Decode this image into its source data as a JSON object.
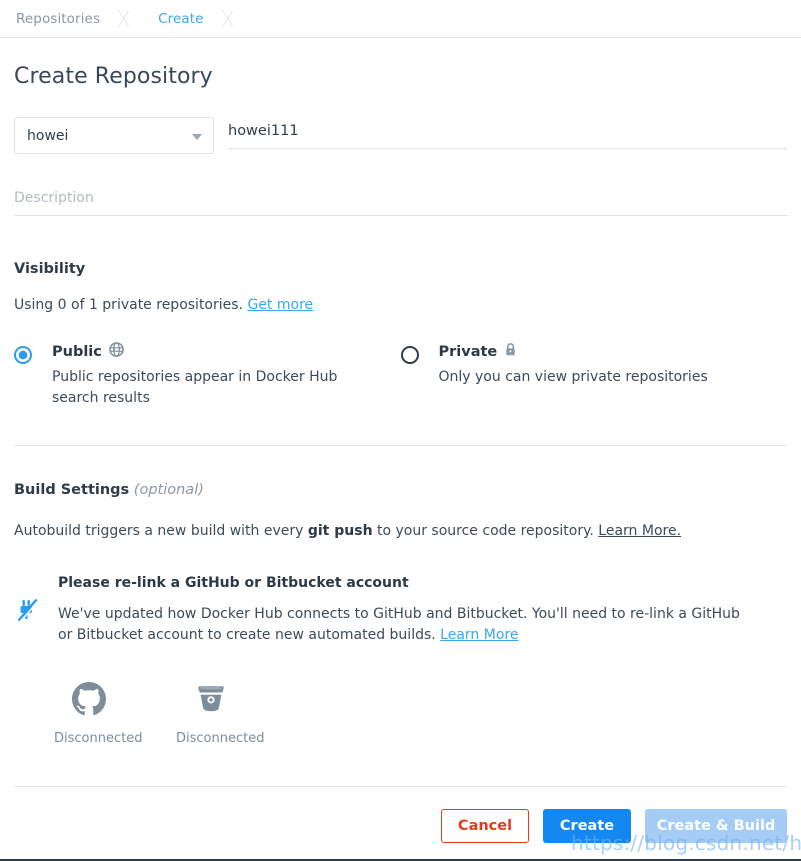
{
  "breadcrumb": {
    "repositories": "Repositories",
    "create": "Create"
  },
  "page_title": "Create Repository",
  "form": {
    "namespace_value": "howei",
    "namespace_caret_icon": "chevron-down-icon",
    "name_value": "howei111",
    "name_placeholder": "",
    "description_value": "",
    "description_placeholder": "Description"
  },
  "visibility": {
    "title": "Visibility",
    "quota_text": "Using 0 of 1 private repositories.",
    "get_more_label": "Get more",
    "options": [
      {
        "label": "Public",
        "icon": "globe-icon",
        "description": "Public repositories appear in Docker Hub search results",
        "selected": true
      },
      {
        "label": "Private",
        "icon": "lock-icon",
        "description": "Only you can view private repositories",
        "selected": false
      }
    ]
  },
  "build_settings": {
    "title": "Build Settings",
    "optional_label": "(optional)",
    "autobuild_prefix": "Autobuild triggers a new build with every ",
    "autobuild_bold": "git push",
    "autobuild_suffix": " to your source code repository. ",
    "learn_more_label": "Learn More.",
    "alert": {
      "icon": "disconnected-plug-icon",
      "heading": "Please re-link a GitHub or Bitbucket account",
      "body_prefix": "We've updated how Docker Hub connects to GitHub and Bitbucket. You'll need to re-link a GitHub or Bitbucket account to create new automated builds. ",
      "learn_more_label": "Learn More"
    },
    "providers": [
      {
        "icon": "github-icon",
        "name": "GitHub",
        "status": "Disconnected"
      },
      {
        "icon": "bitbucket-icon",
        "name": "Bitbucket",
        "status": "Disconnected"
      }
    ]
  },
  "actions": {
    "cancel_label": "Cancel",
    "create_label": "Create",
    "create_build_label": "Create & Build"
  },
  "watermark": "https://blog.csdn.net/howei",
  "colors": {
    "link_blue": "#3aa7f0",
    "primary_button": "#1488f0",
    "primary_button_disabled": "#a4ccf5",
    "cancel_red": "#e03c1b",
    "radio_selected": "#2d9cf0",
    "alert_icon_blue": "#2d9cf0",
    "provider_gray": "#7d8d99",
    "text_dark": "#2c3a47",
    "text_body": "#3c4b59",
    "divider": "#e4e8eb"
  }
}
